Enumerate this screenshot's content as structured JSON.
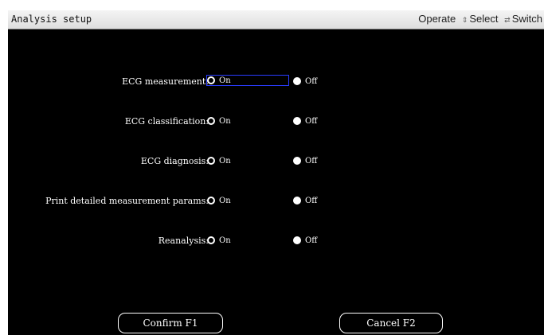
{
  "window": {
    "title": "Analysis setup"
  },
  "hints": {
    "operate": "Operate",
    "select": "Select",
    "switch": "Switch",
    "select_icon": "up-down-arrows-icon",
    "switch_icon": "left-right-arrows-icon"
  },
  "settings": [
    {
      "label": "ECG measurement:",
      "on": "On",
      "off": "Off",
      "selected": "on",
      "focused": true
    },
    {
      "label": "ECG classification:",
      "on": "On",
      "off": "Off",
      "selected": "on",
      "focused": false
    },
    {
      "label": "ECG diagnosis:",
      "on": "On",
      "off": "Off",
      "selected": "on",
      "focused": false
    },
    {
      "label": "Print detailed measurement params:",
      "on": "On",
      "off": "Off",
      "selected": "on",
      "focused": false
    },
    {
      "label": "Reanalysis:",
      "on": "On",
      "off": "Off",
      "selected": "on",
      "focused": false
    }
  ],
  "buttons": {
    "confirm": "Confirm F1",
    "cancel": "Cancel F2"
  },
  "colors": {
    "background": "#000000",
    "text": "#ffffff",
    "focus": "#2a3cff",
    "titlebar": "#e6e6e6"
  }
}
